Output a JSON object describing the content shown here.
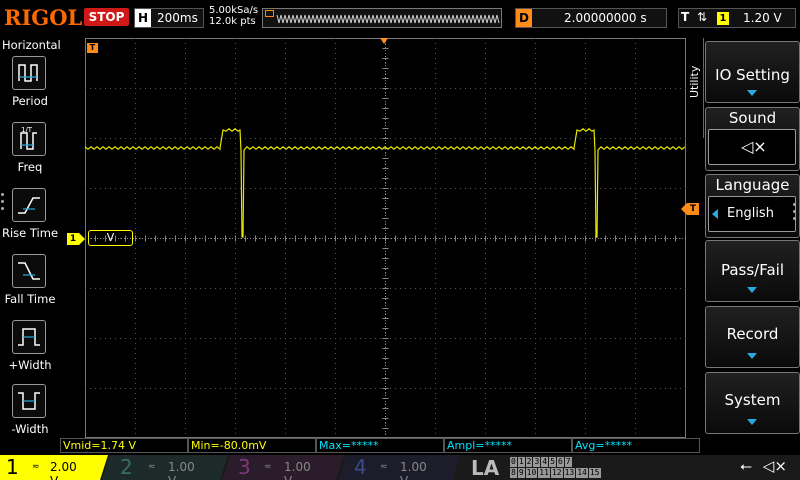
{
  "topbar": {
    "logo": "RIGOL",
    "run_state": "STOP",
    "horizontal": {
      "label": "H",
      "timebase": "200ms"
    },
    "sample_rate": "5.00kSa/s",
    "mem_depth": "12.0k pts",
    "delay": {
      "label": "D",
      "value": "2.00000000 s"
    },
    "trigger": {
      "label": "T",
      "edge": "⇅",
      "source": "1",
      "level": "1.20 V"
    }
  },
  "left_panel": {
    "title": "Horizontal",
    "items": [
      {
        "label": "Period",
        "icon": "period-icon"
      },
      {
        "label": "Freq",
        "icon": "freq-icon"
      },
      {
        "label": "Rise Time",
        "icon": "rise-time-icon"
      },
      {
        "label": "Fall Time",
        "icon": "fall-time-icon"
      },
      {
        "label": "+Width",
        "icon": "pos-width-icon"
      },
      {
        "label": "-Width",
        "icon": "neg-width-icon"
      }
    ]
  },
  "screen": {
    "ch1_marker": "1",
    "voltage_label": "V",
    "trigger_marker": "T",
    "trace_color": "#e6e600"
  },
  "measurements": [
    {
      "text": "Vmid=1.74 V",
      "color": "#ffff00"
    },
    {
      "text": "Min=-80.0mV",
      "color": "#ffff00"
    },
    {
      "text": "Max=*****",
      "color": "#00e5ff"
    },
    {
      "text": "Ampl=*****",
      "color": "#00e5ff"
    },
    {
      "text": "Avg=*****",
      "color": "#00e5ff"
    }
  ],
  "right_menu": {
    "tab_label": "Utility",
    "io_setting": "IO Setting",
    "sound": "Sound",
    "sound_icon": "speaker-muted-icon",
    "sound_glyph": "◁×",
    "language": "Language",
    "language_value": "English",
    "pass_fail": "Pass/Fail",
    "record": "Record",
    "system": "System"
  },
  "bottombar": {
    "channels": [
      {
        "num": "1",
        "coupling": "≂",
        "scale": "2.00 V",
        "color": "#ffff00"
      },
      {
        "num": "2",
        "coupling": "≂",
        "scale": "1.00 V",
        "color": "#00d0d0"
      },
      {
        "num": "3",
        "coupling": "≂",
        "scale": "1.00 V",
        "color": "#ff40ff"
      },
      {
        "num": "4",
        "coupling": "≂",
        "scale": "1.00 V",
        "color": "#3f7fff"
      }
    ],
    "la_label": "LA",
    "la_rows": [
      [
        "0",
        "1",
        "2",
        "3",
        "4",
        "5",
        "6",
        "7"
      ],
      [
        "8",
        "9",
        "10",
        "11",
        "12",
        "13",
        "14",
        "15"
      ]
    ],
    "usb_glyph": "⭠",
    "speaker_glyph": "◁×"
  }
}
